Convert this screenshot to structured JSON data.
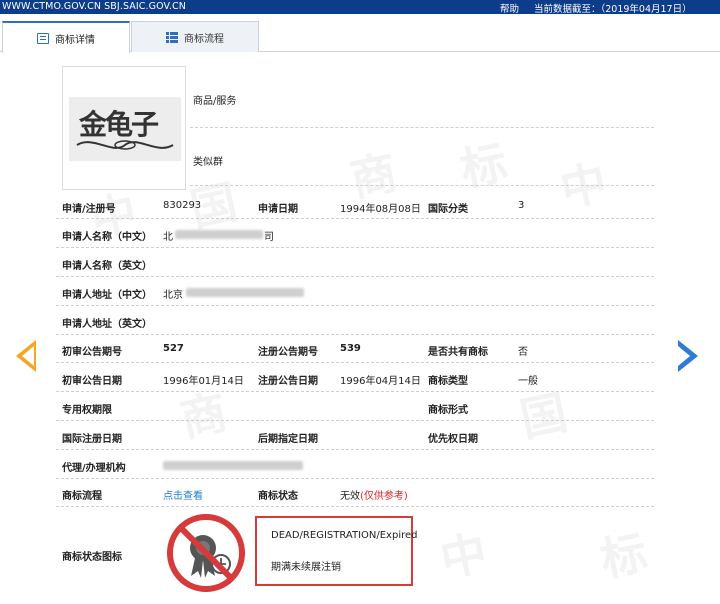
{
  "topbar": {
    "site": "WWW.CTMO.GOV.CN  SBJ.SAIC.GOV.CN",
    "help": "帮助",
    "data_date": "当前数据截至：（2019年04月17日）"
  },
  "tabs": [
    {
      "label": "商标详情",
      "icon": "document-icon",
      "active": true
    },
    {
      "label": "商标流程",
      "icon": "list-icon",
      "active": false
    }
  ],
  "watermark": [
    "中",
    "国",
    "商",
    "标"
  ],
  "logo": {
    "text": "金龟子"
  },
  "labels": {
    "goods_services": "商品/服务",
    "similar_group": "类似群",
    "reg_no": "申请/注册号",
    "app_date": "申请日期",
    "intl_class": "国际分类",
    "applicant_cn": "申请人名称（中文）",
    "applicant_en": "申请人名称（英文）",
    "address_cn": "申请人地址（中文）",
    "address_en": "申请人地址（英文）",
    "prelim_pub_no": "初审公告期号",
    "reg_pub_no": "注册公告期号",
    "shared": "是否共有商标",
    "prelim_pub_date": "初审公告日期",
    "reg_pub_date": "注册公告日期",
    "tm_type": "商标类型",
    "exclusive_period": "专用权期限",
    "tm_form": "商标形式",
    "intl_reg_date": "国际注册日期",
    "later_designation_date": "后期指定日期",
    "priority_date": "优先权日期",
    "agent": "代理/办理机构",
    "tm_flow": "商标流程",
    "tm_status": "商标状态",
    "status_icon": "商标状态图标"
  },
  "values": {
    "reg_no": "830293",
    "app_date": "1994年08月08日",
    "intl_class": "3",
    "applicant_cn_prefix": "北",
    "applicant_cn_suffix": "司",
    "address_cn_prefix": "北京",
    "prelim_pub_no": "527",
    "reg_pub_no": "539",
    "shared": "否",
    "prelim_pub_date": "1996年01月14日",
    "reg_pub_date": "1996年04月14日",
    "tm_type": "一般",
    "flow_link": "点击查看",
    "status_text": "无效",
    "status_note": "(仅供参考)"
  },
  "status_box": {
    "english": "DEAD/REGISTRATION/Expired",
    "chinese": "期满未续展注销"
  },
  "colors": {
    "topbar": "#0c3d8a",
    "accent_blue": "#2f7cd8",
    "accent_orange": "#f5a623",
    "status_red": "#d63a3a"
  }
}
